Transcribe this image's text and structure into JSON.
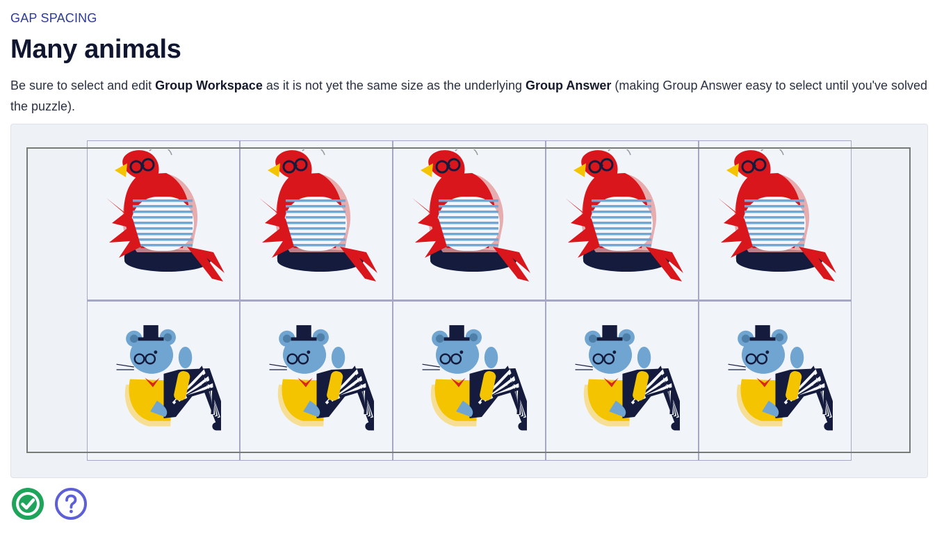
{
  "header": {
    "eyebrow": "GAP SPACING",
    "title": "Many animals"
  },
  "description": {
    "part1": "Be sure to select and edit ",
    "bold1": "Group Workspace",
    "part2": " as it is not yet the same size as the underlying ",
    "bold2": "Group Answer",
    "part3": " (making Group Answer easy to select until you've solved the puzzle)."
  },
  "puzzle": {
    "columns": 5,
    "rows": [
      "parrot",
      "mouse"
    ]
  },
  "icons": {
    "check": "check-circle-icon",
    "help": "question-circle-icon"
  },
  "colors": {
    "accent": "#2c3a9a",
    "check": "#1fa55b",
    "help": "#5d5fd6",
    "parrot_red": "#d8161c",
    "mouse_blue": "#6fa5d0",
    "jacket_yellow": "#f5c400",
    "navy": "#141b3c"
  }
}
